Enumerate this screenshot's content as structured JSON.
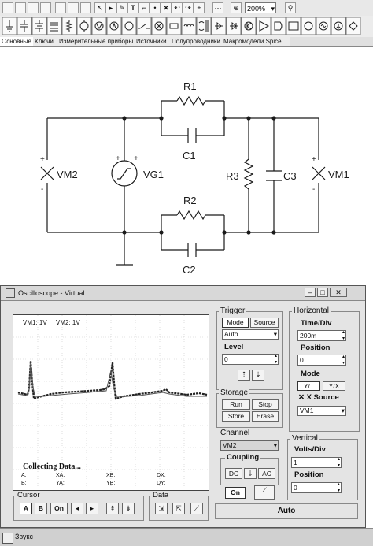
{
  "toolbar": {
    "zoom_value": "200%"
  },
  "tabs": [
    {
      "label": "Основные"
    },
    {
      "label": "Ключи"
    },
    {
      "label": "Измерительные приборы"
    },
    {
      "label": "Источники"
    },
    {
      "label": "Полупроводники"
    },
    {
      "label": "Макромодели Spice"
    }
  ],
  "schematic": {
    "r1": "R1",
    "c1": "C1",
    "r2": "R2",
    "c2": "C2",
    "r3": "R3",
    "c3": "C3",
    "vg1": "VG1",
    "vm1": "VM1",
    "vm2": "VM2",
    "plus": "+",
    "minus": "-"
  },
  "scope": {
    "title": "Oscilloscope - Virtual",
    "channels_label_1": "VM1: 1V",
    "channels_label_2": "VM2: 1V",
    "collecting": "Collecting Data...",
    "readout": {
      "a": "A:",
      "b": "B:",
      "xa": "XA:",
      "ya": "YA:",
      "xb": "XB:",
      "yb": "YB:",
      "dx": "DX:",
      "dy": "DY:"
    },
    "trigger": {
      "title": "Trigger",
      "mode": "Mode",
      "source": "Source",
      "mode_value": "Auto",
      "level": "Level",
      "level_value": "0"
    },
    "horizontal": {
      "title": "Horizontal",
      "time_div": "Time/Div",
      "time_div_value": "200m",
      "position": "Position",
      "position_value": "0",
      "mode": "Mode",
      "yt": "Y/T",
      "yx": "Y/X",
      "x_source": "X Source",
      "x_source_value": "VM1"
    },
    "storage": {
      "title": "Storage",
      "run": "Run",
      "stop": "Stop",
      "store": "Store",
      "erase": "Erase"
    },
    "channel": {
      "title": "Channel",
      "value": "VM2",
      "coupling": "Coupling",
      "dc": "DC",
      "ac": "AC",
      "on": "On"
    },
    "vertical": {
      "title": "Vertical",
      "volts_div": "Volts/Div",
      "volts_div_value": "1",
      "position": "Position",
      "position_value": "0"
    },
    "cursor": {
      "title": "Cursor",
      "a": "A",
      "b": "B",
      "on": "On"
    },
    "data": {
      "title": "Data"
    },
    "auto_label": "Auto"
  },
  "statusbar": {
    "text": "Звукс"
  }
}
